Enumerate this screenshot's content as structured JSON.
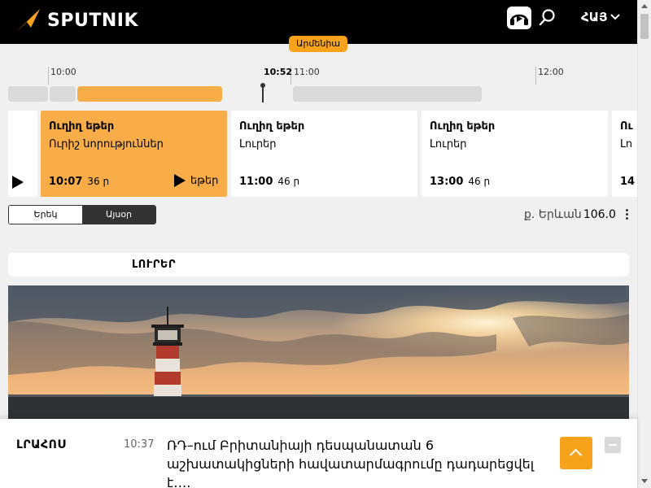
{
  "header": {
    "logo_text": "SPUTNIK",
    "lang_label": "ՀԱՅ",
    "icons": [
      "radio-icon",
      "search-icon",
      "chevron-down-icon"
    ],
    "brand_color": "#f7a21b"
  },
  "region_badge": "Արմենիա",
  "timeline": {
    "ticks": [
      "10:00",
      "11:00",
      "12:00"
    ],
    "now_label": "10:52"
  },
  "cards": [
    {
      "title": "Ուղիղ եթեր",
      "subtitle": "Ուրիշ նորություններ",
      "time": "10:07",
      "duration": "36 ր",
      "play_label": "եթեր",
      "active": true
    },
    {
      "title": "Ուղիղ եթեր",
      "subtitle": "Լուրեր",
      "time": "11:00",
      "duration": "46 ր",
      "active": false
    },
    {
      "title": "Ուղիղ եթեր",
      "subtitle": "Լուրեր",
      "time": "13:00",
      "duration": "46 ր",
      "active": false
    },
    {
      "title": "Ու",
      "subtitle": "Լո",
      "time": "14",
      "duration": "",
      "active": false
    }
  ],
  "day_toggle": {
    "yesterday": "Երեկ",
    "today": "Այսօր",
    "selected": "today"
  },
  "station": {
    "city": "ք. Երևան",
    "frequency": "106.0"
  },
  "news_tab": "ԼՈՒՐԵՐ",
  "live": {
    "label": "ԼՐԱՀՈՍ",
    "time": "10:37",
    "headline": "ՌԴ–ում Բրիտանիայի դեսպանատան 6 աշխատակիցների հավատարմագրումը դադարեցվել է…."
  }
}
